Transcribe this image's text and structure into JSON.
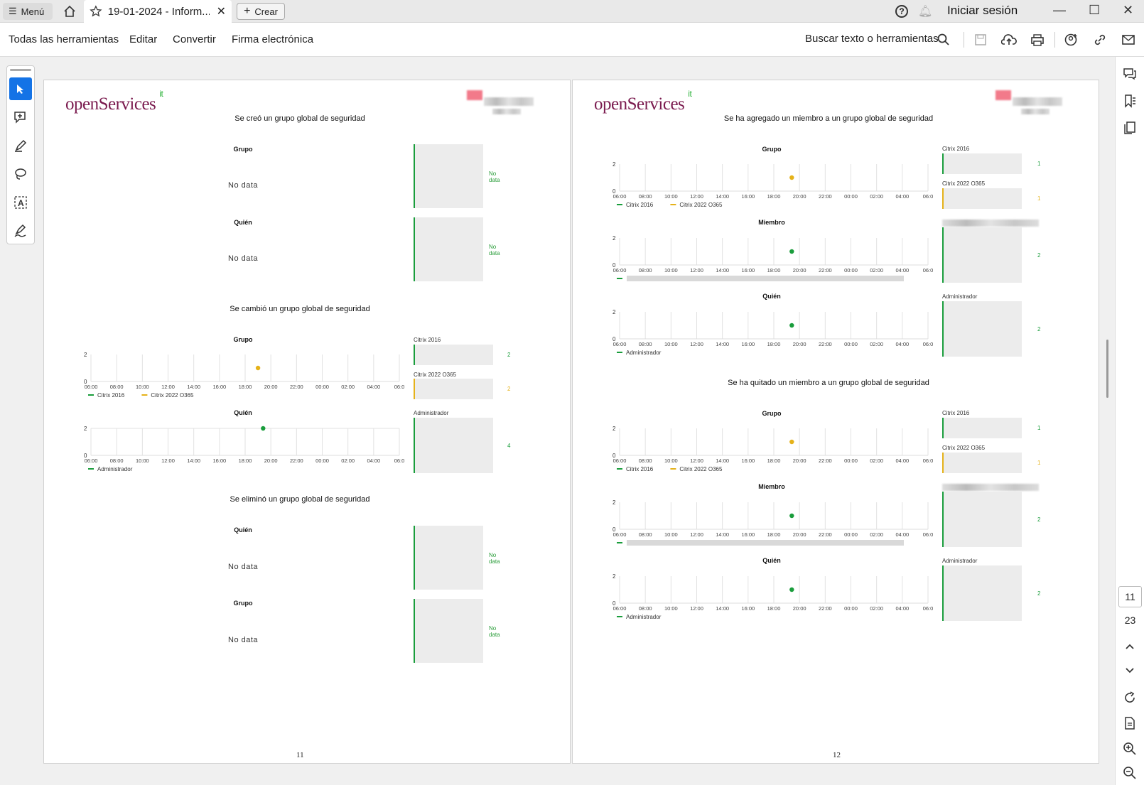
{
  "titlebar": {
    "menu_label": "Menú",
    "tab_title": "19-01-2024 - Inform...",
    "create_label": "Crear",
    "help_icon": "?",
    "signin_label": "Iniciar sesión"
  },
  "toolbar": {
    "all_tools": "Todas las herramientas",
    "edit": "Editar",
    "convert": "Convertir",
    "esign": "Firma electrónica",
    "search_placeholder": "Buscar texto o herramientas"
  },
  "navigation": {
    "current_page": "11",
    "total_pages": "23"
  },
  "pdf": {
    "logo": {
      "text": "openServices",
      "superscript": "it"
    },
    "axis_x_ticks": [
      "06:00",
      "08:00",
      "10:00",
      "12:00",
      "14:00",
      "16:00",
      "18:00",
      "20:00",
      "22:00",
      "00:00",
      "02:00",
      "04:00",
      "06:0"
    ],
    "y_ticks": [
      "2",
      "0"
    ],
    "colors": {
      "green": "#1a9d3c",
      "yellow": "#e5b21a"
    },
    "page11": {
      "number": "11",
      "sec1": {
        "title": "Se creó un grupo global de seguridad",
        "p1_title": "Grupo",
        "p2_title": "Quién",
        "nodata": "No data",
        "nd_small": "No data"
      },
      "sec2": {
        "title": "Se cambió un grupo global de seguridad",
        "p1_title": "Grupo",
        "p2_title": "Quién",
        "legend_grupo": [
          "Citrix 2016",
          "Citrix 2022 O365"
        ],
        "legend_quien": [
          "Administrador"
        ],
        "side1_label1": "Citrix 2016",
        "side1_val1": "2",
        "side1_label2": "Citrix 2022 O365",
        "side1_val2": "2",
        "side2_label": "Administrador",
        "side2_val": "4"
      },
      "sec3": {
        "title": "Se eliminó un grupo global de seguridad",
        "p1_title": "Quién",
        "p2_title": "Grupo",
        "nodata": "No data",
        "nd_small": "No data"
      }
    },
    "page12": {
      "number": "12",
      "sec1": {
        "title": "Se ha agregado un miembro a un grupo global de seguridad",
        "p1_title": "Grupo",
        "p2_title": "Miembro",
        "p3_title": "Quién",
        "legend_grupo": [
          "Citrix 2016",
          "Citrix 2022 O365"
        ],
        "legend_quien": [
          "Administrador"
        ],
        "side1_label1": "Citrix 2016",
        "side1_val1": "1",
        "side1_label2": "Citrix 2022 O365",
        "side1_val2": "1",
        "side2_val": "2",
        "side3_label": "Administrador",
        "side3_val": "2"
      },
      "sec2": {
        "title": "Se ha quitado un miembro a un grupo global de seguridad",
        "p1_title": "Grupo",
        "p2_title": "Miembro",
        "p3_title": "Quién",
        "legend_grupo": [
          "Citrix 2016",
          "Citrix 2022 O365"
        ],
        "legend_quien": [
          "Administrador"
        ],
        "side1_label1": "Citrix 2016",
        "side1_val1": "1",
        "side1_label2": "Citrix 2022 O365",
        "side1_val2": "1",
        "side2_val": "2",
        "side3_label": "Administrador",
        "side3_val": "2"
      }
    }
  }
}
